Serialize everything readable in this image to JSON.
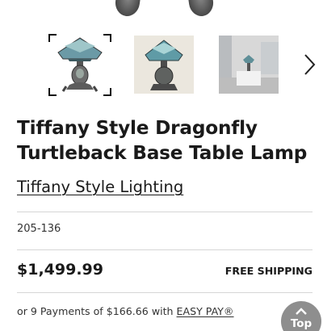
{
  "product": {
    "title_line1": "Tiffany Style Dragonfly",
    "title_line2": "Turtleback Base Table Lamp",
    "brand": "Tiffany Style Lighting",
    "sku": "205-136",
    "price": "$1,499.99",
    "shipping": "FREE SHIPPING"
  },
  "installments": {
    "prefix": "or 9 Payments of $166.66 with ",
    "provider": "EASY PAY®"
  },
  "gallery": {
    "thumbnails": [
      {
        "name": "lamp-front-view"
      },
      {
        "name": "lamp-lit-view"
      },
      {
        "name": "lamp-room-view"
      }
    ],
    "selected_index": 0,
    "next_icon": "chevron-right-icon"
  },
  "back_to_top": {
    "label": "Top",
    "icon": "chevron-up-icon"
  },
  "colors": {
    "text": "#1a1a1a",
    "divider": "#d6d6d6",
    "top_button": "#8e8e8e"
  }
}
